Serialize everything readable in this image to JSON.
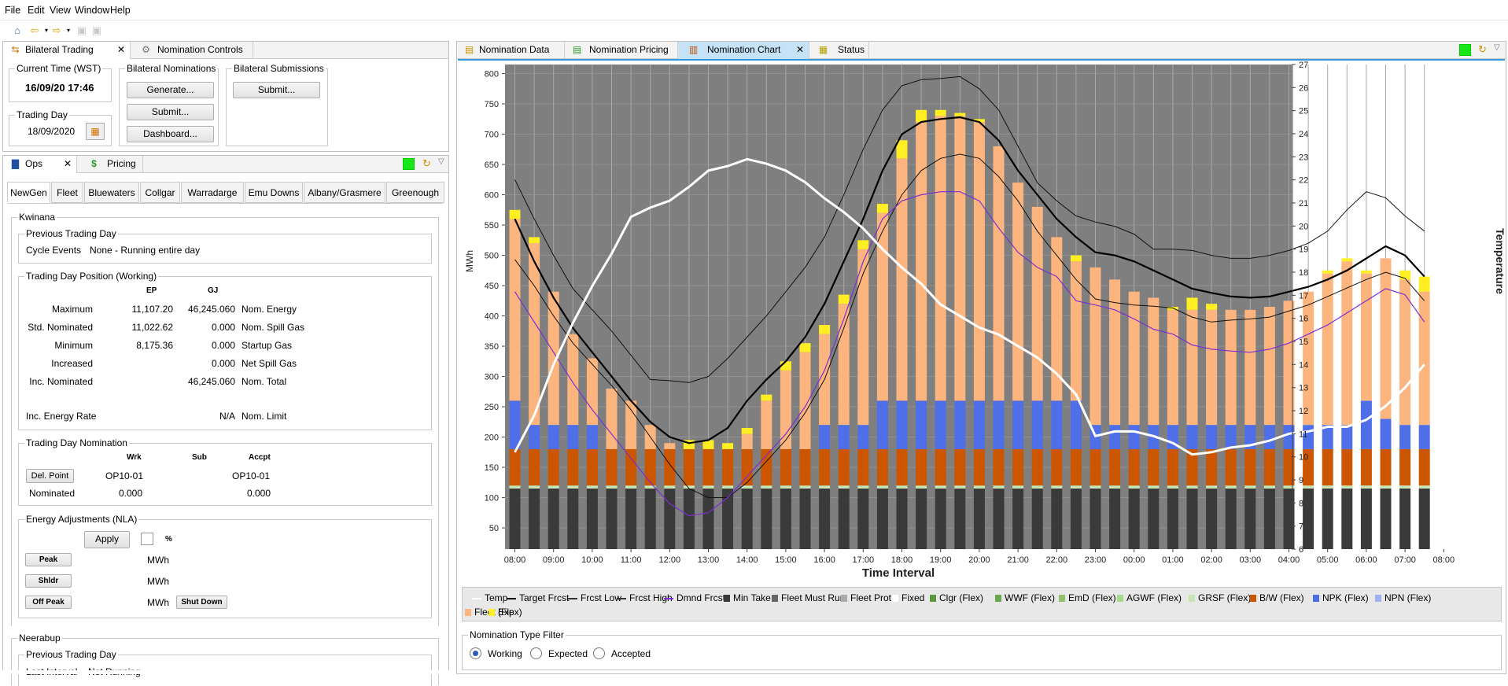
{
  "menu": [
    "File",
    "Edit",
    "View",
    "Window",
    "Help"
  ],
  "left_top": {
    "tabs": [
      {
        "label": "Bilateral Trading",
        "icon": "bilateral-trading-icon"
      },
      {
        "label": "Nomination Controls",
        "icon": "gear-icon"
      }
    ],
    "current_time_label": "Current Time (WST)",
    "current_time": "16/09/20 17:46",
    "trading_day_label": "Trading Day",
    "trading_day": "18/09/2020",
    "bilateral_nominations_label": "Bilateral Nominations",
    "generate": "Generate...",
    "submit": "Submit...",
    "dashboard": "Dashboard...",
    "bilateral_submissions_label": "Bilateral Submissions",
    "submit2": "Submit..."
  },
  "ops": {
    "tabs": [
      {
        "label": "Ops"
      },
      {
        "label": "Pricing"
      }
    ],
    "subtabs": [
      "NewGen",
      "Fleet",
      "Bluewaters",
      "Collgar",
      "Warradarge",
      "Emu Downs",
      "Albany/Grasmere",
      "Greenough"
    ],
    "station": "Kwinana",
    "prev_day_label": "Previous Trading Day",
    "cycle_events_label": "Cycle Events",
    "cycle_events_value": "None - Running entire day",
    "position_label": "Trading Day Position (Working)",
    "col_ep": "EP",
    "col_gj": "GJ",
    "rows": [
      {
        "label": "Maximum",
        "ep": "11,107.20",
        "gj": "46,245.060",
        "desc": "Nom. Energy"
      },
      {
        "label": "Std. Nominated",
        "ep": "11,022.62",
        "gj": "0.000",
        "desc": "Nom. Spill Gas"
      },
      {
        "label": "Minimum",
        "ep": "8,175.36",
        "gj": "0.000",
        "desc": "Startup Gas"
      },
      {
        "label": "Increased",
        "ep": "",
        "gj": "0.000",
        "desc": "Net Spill Gas"
      },
      {
        "label": "Inc. Nominated",
        "ep": "",
        "gj": "46,245.060",
        "desc": "Nom. Total"
      }
    ],
    "inc_energy_rate_label": "Inc. Energy Rate",
    "inc_energy_rate_value": "N/A",
    "nom_limit_label": "Nom. Limit",
    "nomination_label": "Trading Day Nomination",
    "col_wrk": "Wrk",
    "col_sub": "Sub",
    "col_accpt": "Accpt",
    "del_point_label": "Del. Point",
    "del_point_wrk": "OP10-01",
    "del_point_accpt": "OP10-01",
    "nominated_label": "Nominated",
    "nominated_wrk": "0.000",
    "nominated_accpt": "0.000",
    "adjust_label": "Energy Adjustments (NLA)",
    "apply": "Apply",
    "pct": "%",
    "peak": "Peak",
    "shldr": "Shldr",
    "offpeak": "Off Peak",
    "mwh": "MWh",
    "shutdown": "Shut Down",
    "station2": "Neerabup",
    "prev_day_label2": "Previous Trading Day",
    "last_interval_label": "Last Interval",
    "last_interval_value": "Not Running"
  },
  "right_tabs": [
    {
      "label": "Nomination Data",
      "icon": "table-icon"
    },
    {
      "label": "Nomination Pricing",
      "icon": "pricing-icon"
    },
    {
      "label": "Nomination Chart",
      "icon": "chart-icon"
    },
    {
      "label": "Status",
      "icon": "status-icon"
    }
  ],
  "legend": [
    "Temp",
    "Target Frcst",
    "Frcst Low",
    "Frcst High",
    "Dmnd Frcst",
    "Min Take",
    "Fleet Must Run",
    "Fleet Prot",
    "Fixed",
    "Clgr (Flex)",
    "WWF (Flex)",
    "EmD (Flex)",
    "AGWF (Flex)",
    "GRSF (Flex)",
    "B/W (Flex)",
    "NPK (Flex)",
    "NPN (Flex)",
    "Fleet (Flex)",
    "Exp"
  ],
  "colors": {
    "min_take": "#3a3a3a",
    "bw": "#cc5500",
    "npk": "#4f6fe8",
    "fleet": "#fdb57f",
    "exp": "#ffee22",
    "plot_bg": "#7f7f7f",
    "grsf": "#c8e6b4"
  },
  "filter": {
    "label": "Nomination Type Filter",
    "options": [
      "Working",
      "Expected",
      "Accepted"
    ],
    "selected": "Working"
  },
  "chart_data": {
    "type": "bar",
    "xlabel": "Time Interval",
    "ylabel": "MWh",
    "y2label": "Temperature",
    "ylim": [
      15,
      815
    ],
    "y2lim": [
      6,
      27
    ],
    "xticks": [
      "08:00",
      "09:00",
      "10:00",
      "11:00",
      "12:00",
      "13:00",
      "14:00",
      "15:00",
      "16:00",
      "17:00",
      "18:00",
      "19:00",
      "20:00",
      "21:00",
      "22:00",
      "23:00",
      "00:00",
      "01:00",
      "02:00",
      "03:00",
      "04:00",
      "05:00",
      "06:00",
      "07:00",
      "08:00"
    ],
    "yticks": [
      50,
      100,
      150,
      200,
      250,
      300,
      350,
      400,
      450,
      500,
      550,
      600,
      650,
      700,
      750,
      800
    ],
    "y2ticks": [
      6,
      7,
      8,
      9,
      10,
      11,
      12,
      13,
      14,
      15,
      16,
      17,
      18,
      19,
      20,
      21,
      22,
      23,
      24,
      25,
      26,
      27
    ],
    "min_take": 115,
    "grsf": 5,
    "bw": [
      60,
      60,
      60,
      60,
      60,
      60,
      60,
      60,
      60,
      60,
      60,
      60,
      60,
      60,
      60,
      60,
      60,
      60,
      60,
      60,
      60,
      60,
      60,
      60,
      60,
      60,
      60,
      60,
      60,
      60,
      60,
      60,
      60,
      60,
      60,
      60,
      60,
      60,
      60,
      60,
      60,
      60,
      60,
      60,
      60,
      60,
      60,
      60
    ],
    "npk": [
      80,
      40,
      40,
      40,
      40,
      0,
      0,
      0,
      0,
      0,
      0,
      0,
      0,
      0,
      0,
      0,
      40,
      40,
      40,
      80,
      80,
      80,
      80,
      80,
      80,
      80,
      80,
      80,
      80,
      80,
      40,
      40,
      40,
      40,
      40,
      40,
      40,
      40,
      40,
      40,
      40,
      40,
      40,
      40,
      80,
      50,
      40,
      40
    ],
    "fleet": [
      300,
      300,
      220,
      150,
      110,
      100,
      80,
      40,
      10,
      0,
      0,
      0,
      25,
      80,
      130,
      160,
      150,
      200,
      290,
      310,
      400,
      460,
      470,
      470,
      460,
      420,
      360,
      320,
      270,
      230,
      260,
      240,
      220,
      210,
      190,
      190,
      190,
      190,
      190,
      195,
      205,
      220,
      250,
      270,
      210,
      265,
      240,
      220
    ],
    "exp": [
      15,
      10,
      0,
      0,
      0,
      0,
      0,
      0,
      0,
      15,
      15,
      10,
      10,
      10,
      15,
      15,
      15,
      15,
      15,
      15,
      30,
      20,
      10,
      5,
      5,
      0,
      0,
      0,
      0,
      10,
      0,
      0,
      0,
      0,
      5,
      20,
      10,
      0,
      0,
      0,
      0,
      0,
      5,
      5,
      5,
      0,
      15,
      25
    ],
    "target": [
      560,
      490,
      430,
      380,
      340,
      300,
      260,
      225,
      200,
      190,
      195,
      215,
      260,
      295,
      325,
      365,
      420,
      490,
      560,
      640,
      700,
      720,
      725,
      728,
      720,
      690,
      640,
      600,
      560,
      530,
      505,
      500,
      490,
      475,
      460,
      445,
      438,
      432,
      430,
      432,
      440,
      448,
      460,
      475,
      495,
      515,
      500,
      465
    ],
    "low": [
      493,
      450,
      400,
      355,
      320,
      285,
      245,
      200,
      155,
      115,
      100,
      100,
      125,
      160,
      195,
      240,
      295,
      380,
      470,
      540,
      600,
      640,
      660,
      667,
      660,
      630,
      590,
      540,
      500,
      460,
      428,
      422,
      418,
      416,
      413,
      398,
      390,
      393,
      395,
      398,
      408,
      418,
      432,
      446,
      460,
      472,
      462,
      425
    ],
    "high": [
      625,
      560,
      500,
      445,
      410,
      375,
      335,
      295,
      293,
      290,
      300,
      330,
      365,
      400,
      440,
      480,
      530,
      600,
      675,
      740,
      780,
      790,
      792,
      795,
      775,
      740,
      680,
      620,
      590,
      565,
      555,
      548,
      535,
      510,
      510,
      508,
      500,
      495,
      495,
      500,
      508,
      520,
      540,
      575,
      605,
      595,
      565,
      540
    ],
    "dmnd": [
      440,
      390,
      340,
      290,
      245,
      205,
      165,
      125,
      90,
      70,
      75,
      100,
      135,
      170,
      205,
      250,
      310,
      395,
      490,
      560,
      590,
      600,
      605,
      605,
      590,
      545,
      505,
      480,
      465,
      425,
      418,
      410,
      395,
      378,
      370,
      352,
      345,
      342,
      340,
      345,
      355,
      370,
      385,
      405,
      425,
      445,
      435,
      390
    ],
    "temp": [
      10.2,
      11.8,
      14.0,
      15.8,
      17.4,
      18.8,
      20.4,
      20.8,
      21.1,
      21.7,
      22.4,
      22.6,
      22.9,
      22.7,
      22.4,
      21.9,
      21.2,
      20.6,
      19.9,
      19.0,
      18.2,
      17.5,
      16.6,
      16.1,
      15.6,
      15.3,
      14.8,
      14.3,
      13.6,
      12.7,
      10.9,
      11.1,
      11.1,
      10.9,
      10.6,
      10.1,
      10.2,
      10.4,
      10.5,
      10.7,
      11.0,
      11.1,
      11.3,
      11.3,
      11.6,
      12.2,
      13.0,
      14.0
    ]
  }
}
